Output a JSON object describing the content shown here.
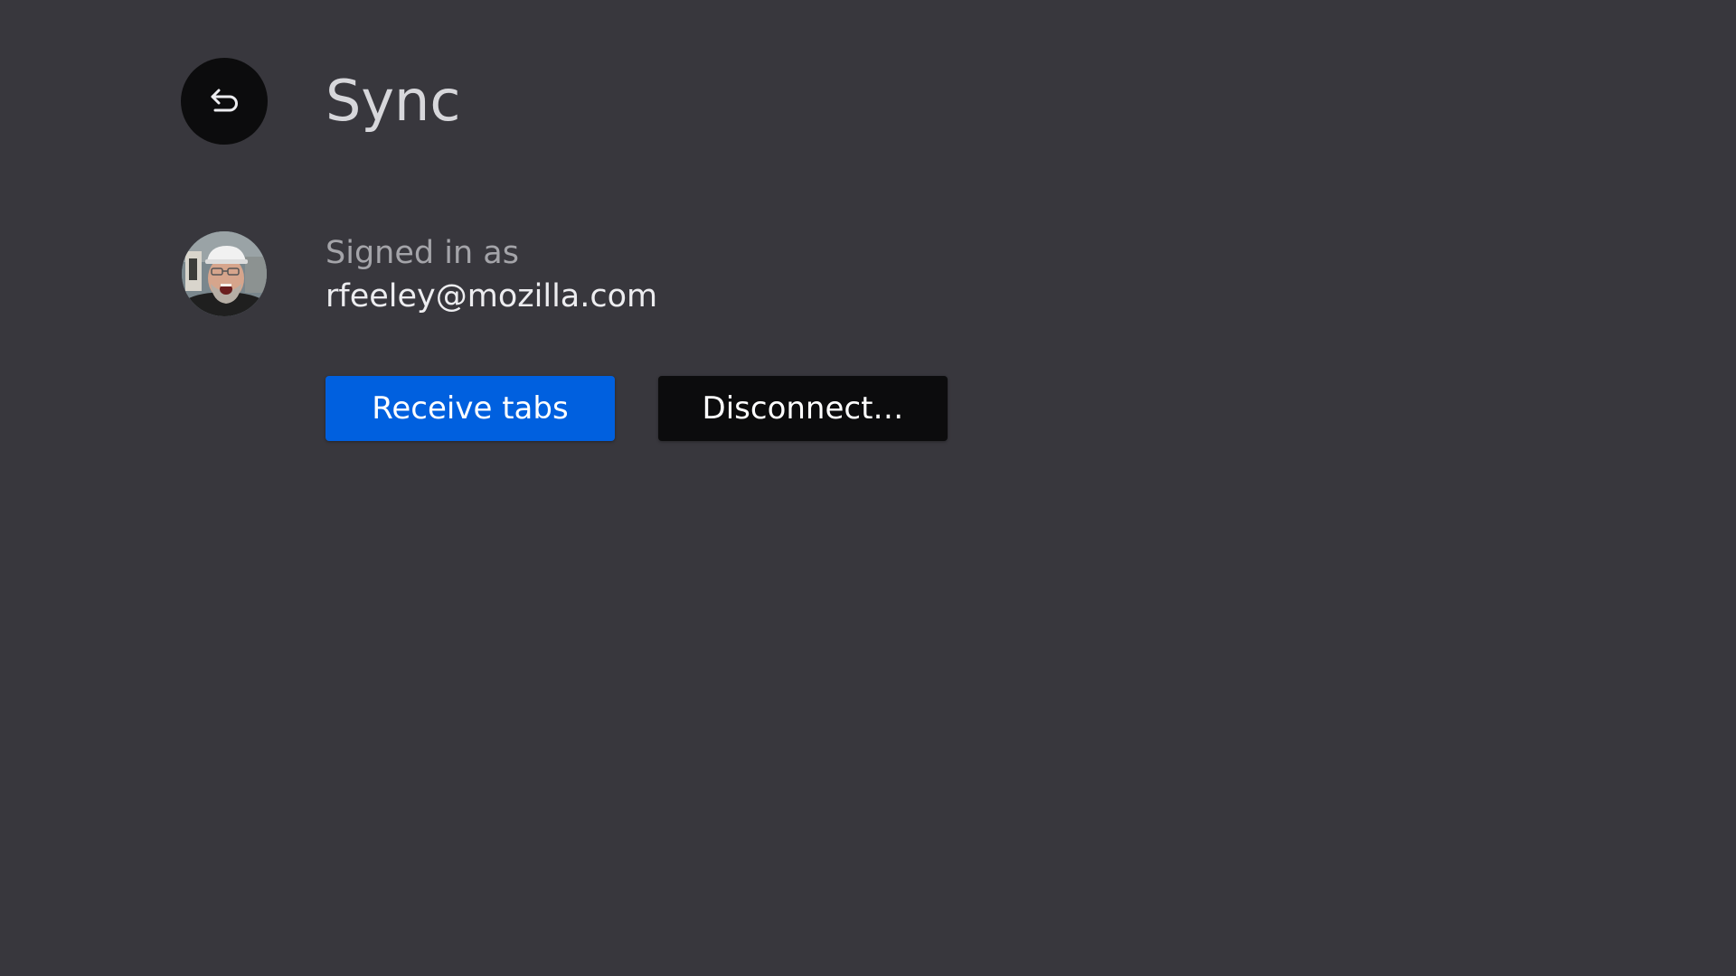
{
  "page": {
    "title": "Sync",
    "background_color": "#38373d"
  },
  "back_button": {
    "icon": "back-arrow-icon"
  },
  "account": {
    "avatar": "user-avatar-photo",
    "signed_in_label": "Signed in as",
    "email": "rfeeley@mozilla.com"
  },
  "actions": {
    "receive_tabs_label": "Receive tabs",
    "receive_tabs_color": "#0060df",
    "disconnect_label": "Disconnect…",
    "disconnect_color": "#0c0c0d"
  }
}
